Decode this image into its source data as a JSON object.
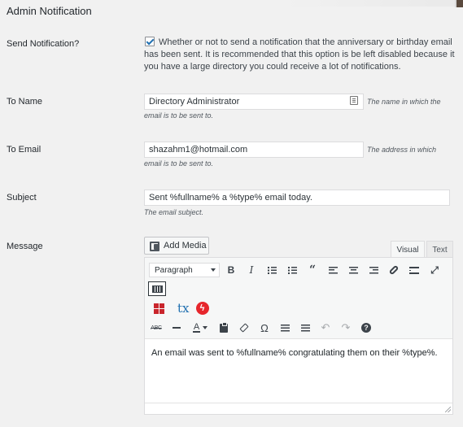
{
  "section": {
    "title": "Admin Notification"
  },
  "send_notification": {
    "label": "Send Notification?",
    "checked": true,
    "description": "Whether or not to send a notification that the anniversary or birthday email has been sent. It is recommended that this option is be left disabled because it you have a large directory you could receive a lot of notifications."
  },
  "to_name": {
    "label": "To Name",
    "value": "Directory Administrator",
    "desc_line1": "The name in which the",
    "desc_line2": "email is to be sent to."
  },
  "to_email": {
    "label": "To Email",
    "value": "shazahm1@hotmail.com",
    "desc_line1": "The address in which",
    "desc_line2": "email is to be sent to."
  },
  "subject": {
    "label": "Subject",
    "value": "Sent %fullname% a %type% email today.",
    "description": "The email subject."
  },
  "message": {
    "label": "Message",
    "add_media_label": "Add Media",
    "tabs": {
      "visual": "Visual",
      "text": "Text"
    },
    "format_select": "Paragraph",
    "toolbar1": [
      "bold-icon",
      "italic-icon",
      "bullet-list-icon",
      "numbered-list-icon",
      "blockquote-icon",
      "align-left-icon",
      "align-center-icon",
      "align-right-icon",
      "link-icon",
      "read-more-icon",
      "fullscreen-icon"
    ],
    "toolbar2": [
      "strikethrough-icon",
      "horizontal-line-icon",
      "text-color-icon",
      "paste-text-icon",
      "clear-formatting-icon",
      "special-character-icon",
      "outdent-icon",
      "indent-icon",
      "undo-icon",
      "redo-icon",
      "help-icon"
    ],
    "bold_glyph": "B",
    "italic_glyph": "I",
    "quote_glyph": "“",
    "fullscreen_glyph": "⤢",
    "strike_glyph": "ABC",
    "color_glyph": "A",
    "omega_glyph": "Ω",
    "undo_glyph": "↶",
    "redo_glyph": "↷",
    "help_glyph": "?",
    "tx_glyph": "tx",
    "bolt_glyph": "ϟ",
    "content": "An email was sent to %fullname% congratulating them on their %type%."
  }
}
